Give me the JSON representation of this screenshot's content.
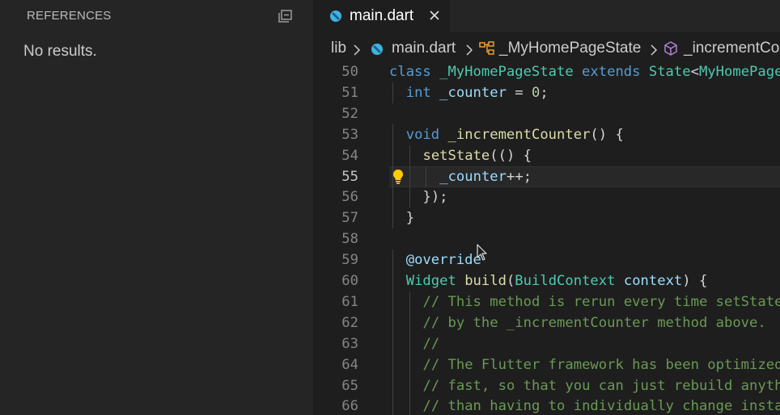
{
  "sidebar": {
    "title": "REFERENCES",
    "empty_message": "No results."
  },
  "tab": {
    "label": "main.dart"
  },
  "breadcrumb": {
    "folder": "lib",
    "file": "main.dart",
    "class": "_MyHomePageState",
    "method": "_incrementCo"
  },
  "code_lines": [
    {
      "n": "50",
      "tokens": [
        [
          "kw",
          "class"
        ],
        [
          "pn",
          " "
        ],
        [
          "cls",
          "_MyHomePageState"
        ],
        [
          "pn",
          " "
        ],
        [
          "kw",
          "extends"
        ],
        [
          "pn",
          " "
        ],
        [
          "cls",
          "State"
        ],
        [
          "pn",
          "<"
        ],
        [
          "cls",
          "MyHomePage"
        ]
      ]
    },
    {
      "n": "51",
      "tokens": [
        [
          "kw",
          "int"
        ],
        [
          "pn",
          " "
        ],
        [
          "var",
          "_counter"
        ],
        [
          "pn",
          " = "
        ],
        [
          "num",
          "0"
        ],
        [
          "pn",
          ";"
        ]
      ]
    },
    {
      "n": "52",
      "tokens": []
    },
    {
      "n": "53",
      "tokens": [
        [
          "kw",
          "void"
        ],
        [
          "pn",
          " "
        ],
        [
          "fn",
          "_incrementCounter"
        ],
        [
          "pn",
          "() {"
        ]
      ]
    },
    {
      "n": "54",
      "tokens": [
        [
          "fn",
          "setState"
        ],
        [
          "pn",
          "(() {"
        ]
      ]
    },
    {
      "n": "55",
      "tokens": [
        [
          "var",
          "_counter"
        ],
        [
          "pn",
          "++;"
        ]
      ]
    },
    {
      "n": "56",
      "tokens": [
        [
          "pn",
          "});"
        ]
      ]
    },
    {
      "n": "57",
      "tokens": [
        [
          "pn",
          "}"
        ]
      ]
    },
    {
      "n": "58",
      "tokens": []
    },
    {
      "n": "59",
      "tokens": [
        [
          "ann",
          "@override"
        ]
      ]
    },
    {
      "n": "60",
      "tokens": [
        [
          "cls",
          "Widget"
        ],
        [
          "pn",
          " "
        ],
        [
          "fn",
          "build"
        ],
        [
          "pn",
          "("
        ],
        [
          "cls",
          "BuildContext"
        ],
        [
          "pn",
          " "
        ],
        [
          "var",
          "context"
        ],
        [
          "pn",
          ") {"
        ]
      ]
    },
    {
      "n": "61",
      "tokens": [
        [
          "cm",
          "// This method is rerun every time setState"
        ]
      ]
    },
    {
      "n": "62",
      "tokens": [
        [
          "cm",
          "// by the _incrementCounter method above."
        ]
      ]
    },
    {
      "n": "63",
      "tokens": [
        [
          "cm",
          "//"
        ]
      ]
    },
    {
      "n": "64",
      "tokens": [
        [
          "cm",
          "// The Flutter framework has been optimized"
        ]
      ]
    },
    {
      "n": "65",
      "tokens": [
        [
          "cm",
          "// fast, so that you can just rebuild anyth"
        ]
      ]
    },
    {
      "n": "66",
      "tokens": [
        [
          "cm",
          "// than having to individually change insta"
        ]
      ]
    }
  ],
  "active_line": "55",
  "icons": {
    "collapse": "collapse-all-icon",
    "dart_file": "dart-file-icon",
    "close": "close-icon",
    "class_symbol": "class-symbol-icon",
    "method_symbol": "method-symbol-icon",
    "lightbulb": "lightbulb-icon",
    "mouse_cursor": "mouse-cursor-icon"
  },
  "colors": {
    "keyword": "#569cd6",
    "type": "#4ec9b0",
    "function": "#dcdcaa",
    "variable": "#9cdcfe",
    "number": "#b5cea8",
    "comment": "#6a9955",
    "lightbulb": "#ffcc00"
  }
}
